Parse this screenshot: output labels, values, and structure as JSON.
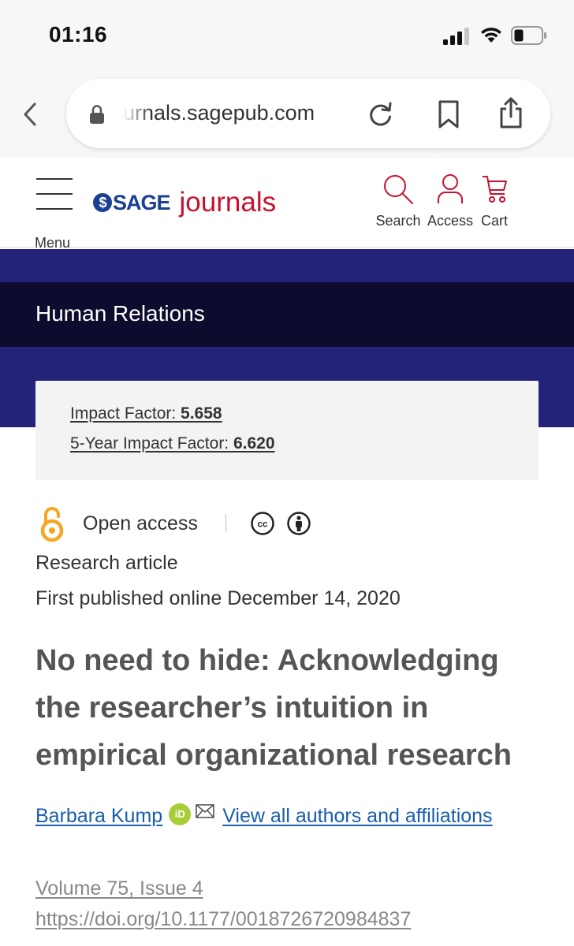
{
  "status": {
    "time": "01:16"
  },
  "browser": {
    "url": "urnals.sagepub.com"
  },
  "header": {
    "menu_label": "Menu",
    "logo_brand": "SAGE",
    "logo_journals": "journals",
    "search_label": "Search",
    "access_label": "Access",
    "cart_label": "Cart"
  },
  "journal": {
    "name": "Human Relations",
    "impact_factor_label": "Impact Factor: ",
    "impact_factor_value": "5.658",
    "five_year_label": "5-Year Impact Factor: ",
    "five_year_value": "6.620"
  },
  "article": {
    "access": "Open access",
    "type": "Research article",
    "published": "First published online December 14, 2020",
    "title": "No need to hide: Acknowledging the researcher’s intuition in empirical organizational research",
    "author": "Barbara Kump",
    "orcid_label": "iD",
    "all_authors_link": "View all authors and affiliations",
    "volume": "Volume 75, Issue 4",
    "doi": "https://doi.org/10.1177/0018726720984837"
  },
  "colors": {
    "brand_blue": "#1b3f94",
    "brand_red": "#c8102e",
    "banner_navy": "#24237a",
    "banner_dark": "#0d0c2e",
    "link_blue": "#1a5dab",
    "open_access_orange": "#f5a623",
    "orcid_green": "#a6ce39"
  },
  "icons": [
    "signal-icon",
    "wifi-icon",
    "battery-icon",
    "back-chevron-icon",
    "lock-icon",
    "reload-icon",
    "bookmark-icon",
    "share-icon",
    "hamburger-icon",
    "search-icon",
    "user-icon",
    "cart-icon",
    "open-access-icon",
    "creative-commons-icon",
    "attribution-icon",
    "orcid-icon",
    "mail-icon"
  ]
}
